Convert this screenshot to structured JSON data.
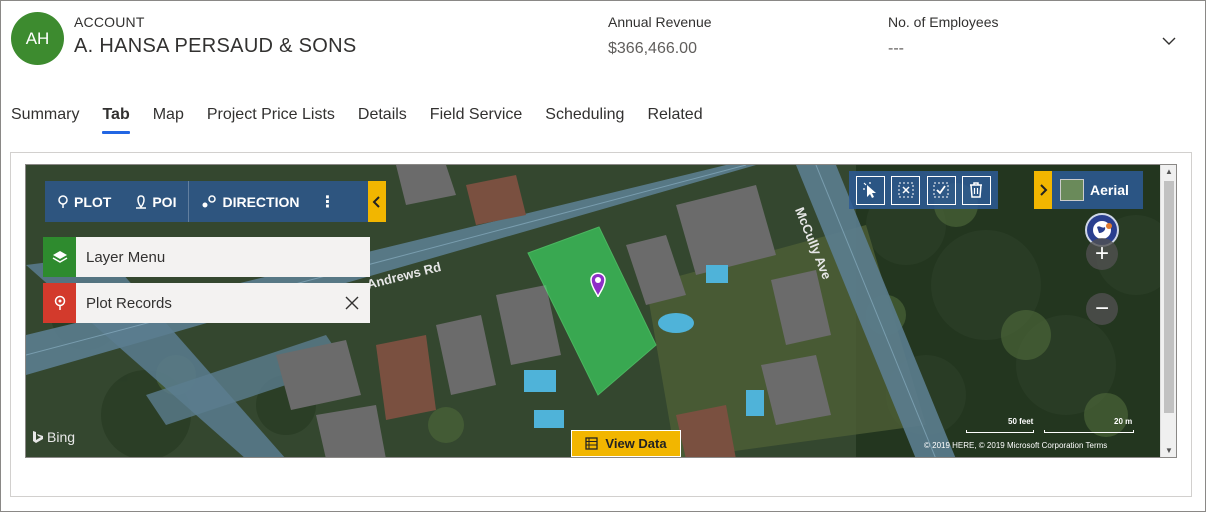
{
  "header": {
    "avatar_initials": "AH",
    "entity_type": "ACCOUNT",
    "entity_name": "A. HANSA PERSAUD & SONS",
    "fields": [
      {
        "label": "Annual Revenue",
        "value": "$366,466.00"
      },
      {
        "label": "No. of Employees",
        "value": "---"
      }
    ],
    "expand_icon": "chevron-down-icon"
  },
  "tabs": [
    "Summary",
    "Tab",
    "Map",
    "Project Price Lists",
    "Details",
    "Field Service",
    "Scheduling",
    "Related"
  ],
  "active_tab": "Tab",
  "map": {
    "toolbar": {
      "plot": "PLOT",
      "poi": "POI",
      "direction": "DIRECTION",
      "more": "⋮"
    },
    "panels": {
      "layer_menu": "Layer Menu",
      "plot_records": "Plot Records"
    },
    "aerial_label": "Aerial",
    "view_data_label": "View Data",
    "bing_label": "Bing",
    "scale_feet": "50 feet",
    "scale_meters": "20 m",
    "copyright": "© 2019 HERE, © 2019 Microsoft Corporation  Terms",
    "road_labels": [
      "Andrews Rd",
      "McCully Ave"
    ],
    "colors": {
      "toolbar_blue": "#2d5a96",
      "accent_yellow": "#f2b600",
      "parcel_green": "#3ddc64",
      "pin_purple": "#8e2fc7",
      "layer_icon_green": "#2e8b2e",
      "plot_icon_red": "#d33a2c"
    }
  },
  "colors": {
    "avatar": "#3d8b2f",
    "active_tab_underline": "#2266e3"
  }
}
